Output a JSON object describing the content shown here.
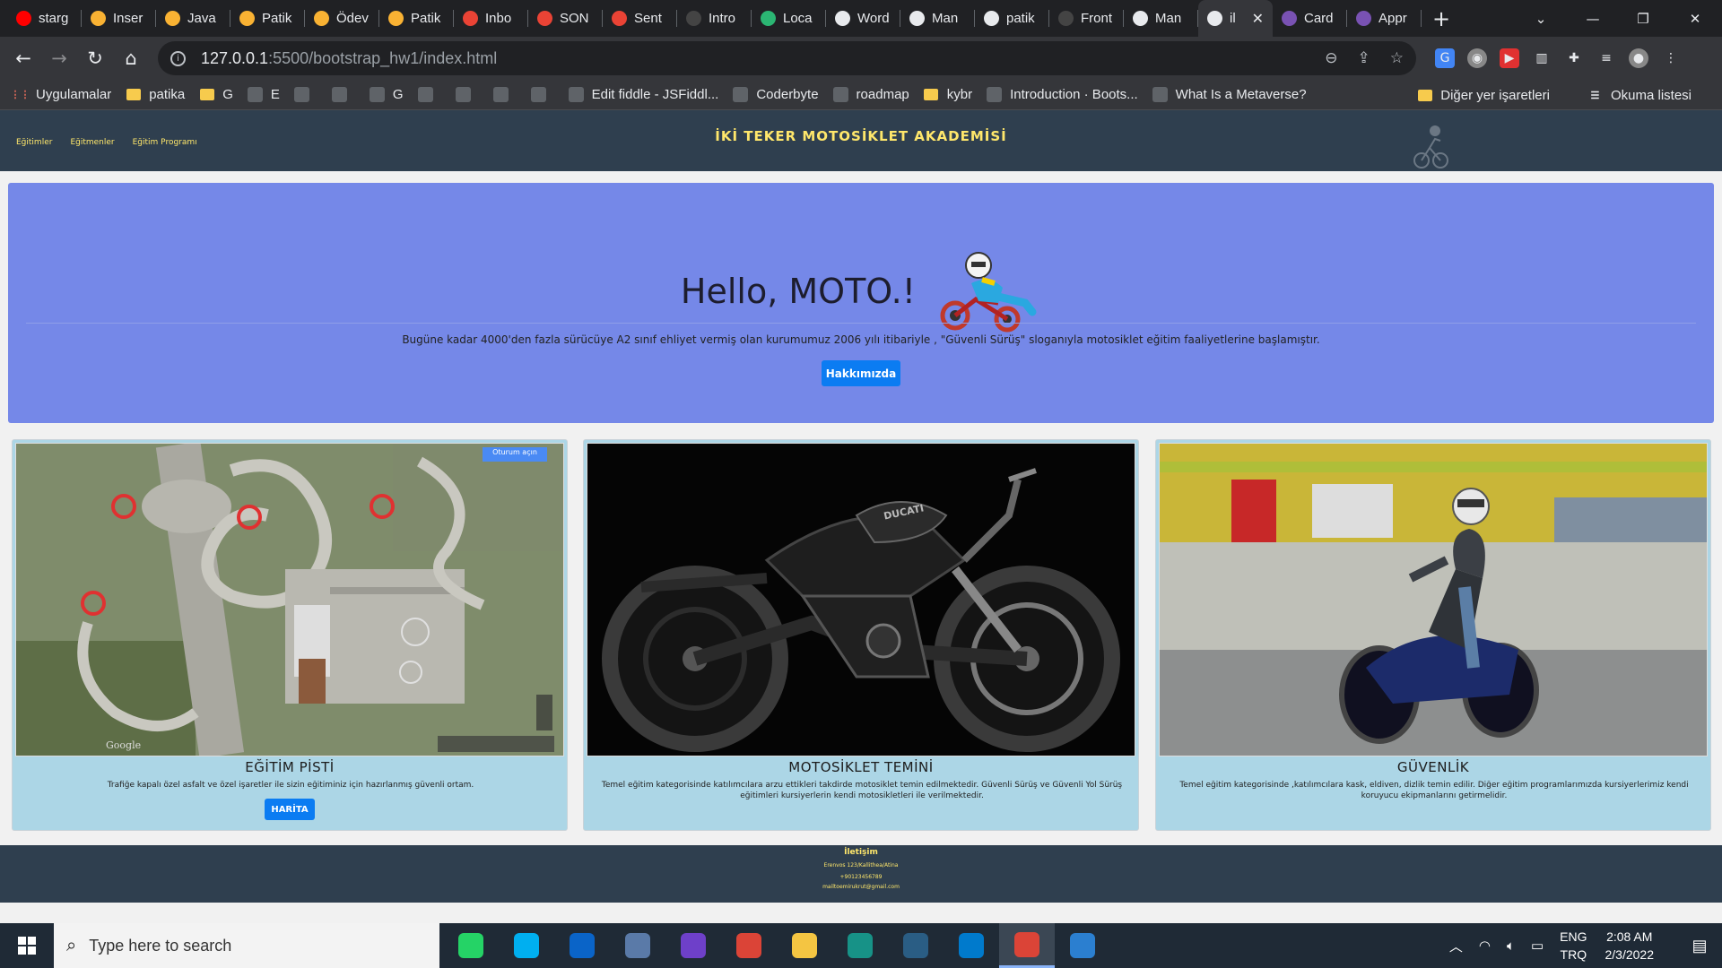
{
  "browser": {
    "tabs": [
      {
        "label": "starg",
        "icon": "youtube-icon",
        "color": "#ff0000"
      },
      {
        "label": "Inser",
        "icon": "circle-icon",
        "color": "#f9b233"
      },
      {
        "label": "Java",
        "icon": "circle-icon",
        "color": "#f9b233"
      },
      {
        "label": "Patik",
        "icon": "circle-icon",
        "color": "#f9b233"
      },
      {
        "label": "Ödev",
        "icon": "circle-icon",
        "color": "#f9b233"
      },
      {
        "label": "Patik",
        "icon": "circle-icon",
        "color": "#f9b233"
      },
      {
        "label": "Inbo",
        "icon": "gmail-icon",
        "color": "#ea4335"
      },
      {
        "label": "SON",
        "icon": "gmail-icon",
        "color": "#ea4335"
      },
      {
        "label": "Sent",
        "icon": "gmail-icon",
        "color": "#ea4335"
      },
      {
        "label": "Intro",
        "icon": "wordpress-icon",
        "color": "#444"
      },
      {
        "label": "Loca",
        "icon": "diamond-icon",
        "color": "#2bb673"
      },
      {
        "label": "Word",
        "icon": "wordpress-icon",
        "color": "#e8eaed"
      },
      {
        "label": "Man",
        "icon": "wordpress-icon",
        "color": "#e8eaed"
      },
      {
        "label": "patik",
        "icon": "wordpress-icon",
        "color": "#e8eaed"
      },
      {
        "label": "Front",
        "icon": "github-icon",
        "color": "#444"
      },
      {
        "label": "Man",
        "icon": "wordpress-icon",
        "color": "#e8eaed"
      },
      {
        "label": "il",
        "icon": "globe-icon",
        "color": "#e8eaed",
        "active": true
      },
      {
        "label": "Card",
        "icon": "bootstrap-icon",
        "color": "#7952b3"
      },
      {
        "label": "Appr",
        "icon": "bootstrap-icon",
        "color": "#7952b3"
      }
    ],
    "url_host": "127.0.0.1",
    "url_path": ":5500/bootstrap_hw1/index.html",
    "bookmarks": [
      {
        "label": "Uygulamalar",
        "icon": "apps-grid-icon"
      },
      {
        "label": "patika",
        "icon": "folder-icon"
      },
      {
        "label": "G",
        "icon": "folder-icon"
      },
      {
        "label": "E",
        "icon": "tumblr-icon"
      },
      {
        "label": "",
        "icon": "download-icon"
      },
      {
        "label": "",
        "icon": "red-circle-icon"
      },
      {
        "label": "G",
        "icon": "globe-icon"
      },
      {
        "label": "",
        "icon": "block-icon"
      },
      {
        "label": "",
        "icon": "w-icon"
      },
      {
        "label": "",
        "icon": "bird-icon"
      },
      {
        "label": "",
        "icon": "pe-icon"
      },
      {
        "label": "Edit fiddle - JSFiddl...",
        "icon": "cloud-icon"
      },
      {
        "label": "Coderbyte",
        "icon": "coderbyte-icon"
      },
      {
        "label": "roadmap",
        "icon": "roadmap-icon"
      },
      {
        "label": "kybr",
        "icon": "folder-icon"
      },
      {
        "label": "Introduction · Boots...",
        "icon": "bootstrap-icon"
      },
      {
        "label": "What Is a Metaverse?",
        "icon": "g-icon"
      }
    ],
    "bookmarks_right": [
      {
        "label": "Diğer yer işaretleri",
        "icon": "folder-icon"
      },
      {
        "label": "Okuma listesi",
        "icon": "reading-list-icon"
      }
    ]
  },
  "site": {
    "nav": [
      "Eğitimler",
      "Eğitmenler",
      "Eğitim Programı"
    ],
    "brand": "İKİ TEKER MOTOSİKLET AKADEMİSİ",
    "hero_title": "Hello, MOTO.!",
    "hero_text": "Bugüne kadar 4000'den fazla sürücüye A2 sınıf ehliyet vermiş olan kurumumuz 2006 yılı itibariyle , \"Güvenli Sürüş\" sloganıyla motosiklet eğitim faaliyetlerine başlamıştır.",
    "hero_button": "Hakkımızda",
    "cards": [
      {
        "title": "EĞİTİM PİSTİ",
        "text": "Trafiğe kapalı özel asfalt ve özel işaretler ile sizin eğitiminiz için hazırlanmış güvenli ortam.",
        "button": "HARİTA",
        "map_badge": "Oturum açın",
        "map_watermark": "Google"
      },
      {
        "title": "MOTOSİKLET TEMİNİ",
        "text": "Temel eğitim kategorisinde katılımcılara arzu ettikleri takdirde motosiklet temin edilmektedir. Güvenli Sürüş ve Güvenli Yol Sürüş eğitimleri kursiyerlerin kendi motosikletleri ile verilmektedir.",
        "bike_brand": "DUCATI"
      },
      {
        "title": "GÜVENLİK",
        "text": "Temel eğitim kategorisinde ,katılımcılara kask, eldiven, dizlik temin edilir. Diğer eğitim programlarımızda kursiyerlerimiz kendi koruyucu ekipmanlarını getirmelidir."
      }
    ],
    "footer_title": "İletişim",
    "footer_address": "Erenvos 123/Kallithea/Atina",
    "footer_phone": "+90123456789",
    "footer_email": "mailtoemirukrut@gmail.com"
  },
  "taskbar": {
    "search_placeholder": "Type here to search",
    "apps": [
      {
        "name": "whatsapp-icon",
        "color": "#25d366"
      },
      {
        "name": "skype-icon",
        "color": "#00aff0"
      },
      {
        "name": "outlook-icon",
        "color": "#0a64c8"
      },
      {
        "name": "network-drive-icon",
        "color": "#5a7aa8"
      },
      {
        "name": "github-desktop-icon",
        "color": "#6e40c9"
      },
      {
        "name": "chrome-icon",
        "color": "#db4437"
      },
      {
        "name": "file-explorer-icon",
        "color": "#f4c542"
      },
      {
        "name": "gitkraken-icon",
        "color": "#179287"
      },
      {
        "name": "wordpress-icon",
        "color": "#2a5d84"
      },
      {
        "name": "vscode-icon",
        "color": "#007acc"
      },
      {
        "name": "chrome-icon",
        "color": "#db4437",
        "active": true
      },
      {
        "name": "photos-icon",
        "color": "#2b7fd0"
      }
    ],
    "lang_top": "ENG",
    "lang_bottom": "TRQ",
    "time": "2:08 AM",
    "date": "2/3/2022"
  }
}
